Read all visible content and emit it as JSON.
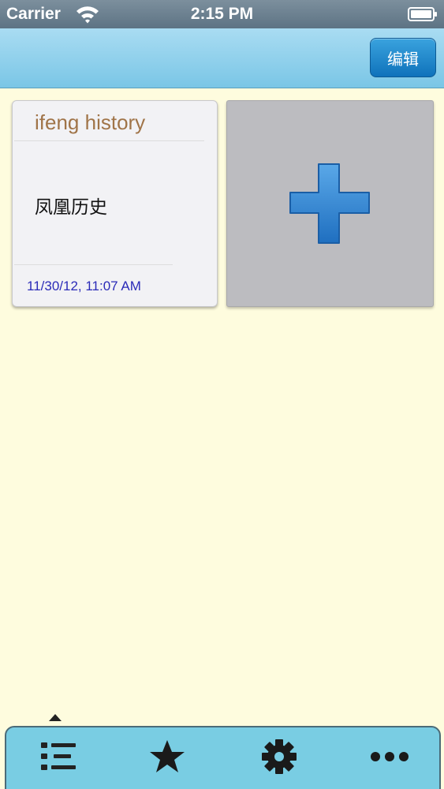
{
  "status_bar": {
    "carrier": "Carrier",
    "time": "2:15 PM",
    "wifi_icon": "wifi-icon",
    "battery_icon": "battery-icon"
  },
  "nav_bar": {
    "edit_label": "编辑"
  },
  "notes": [
    {
      "title": "ifeng history",
      "body": "凤凰历史",
      "date": "11/30/12, 11:07 AM"
    }
  ],
  "add_card": {
    "icon": "plus-icon"
  },
  "tab_bar": {
    "items": [
      {
        "icon": "list-icon"
      },
      {
        "icon": "star-icon"
      },
      {
        "icon": "gear-icon"
      },
      {
        "icon": "more-icon"
      }
    ]
  },
  "colors": {
    "background": "#fefcde",
    "nav_bar": "#8fd1ee",
    "edit_button": "#1a85cc",
    "note_title": "#a07448",
    "note_date": "#2b2bb8",
    "tab_bar": "#79cde3",
    "plus": "#2f86d3"
  }
}
